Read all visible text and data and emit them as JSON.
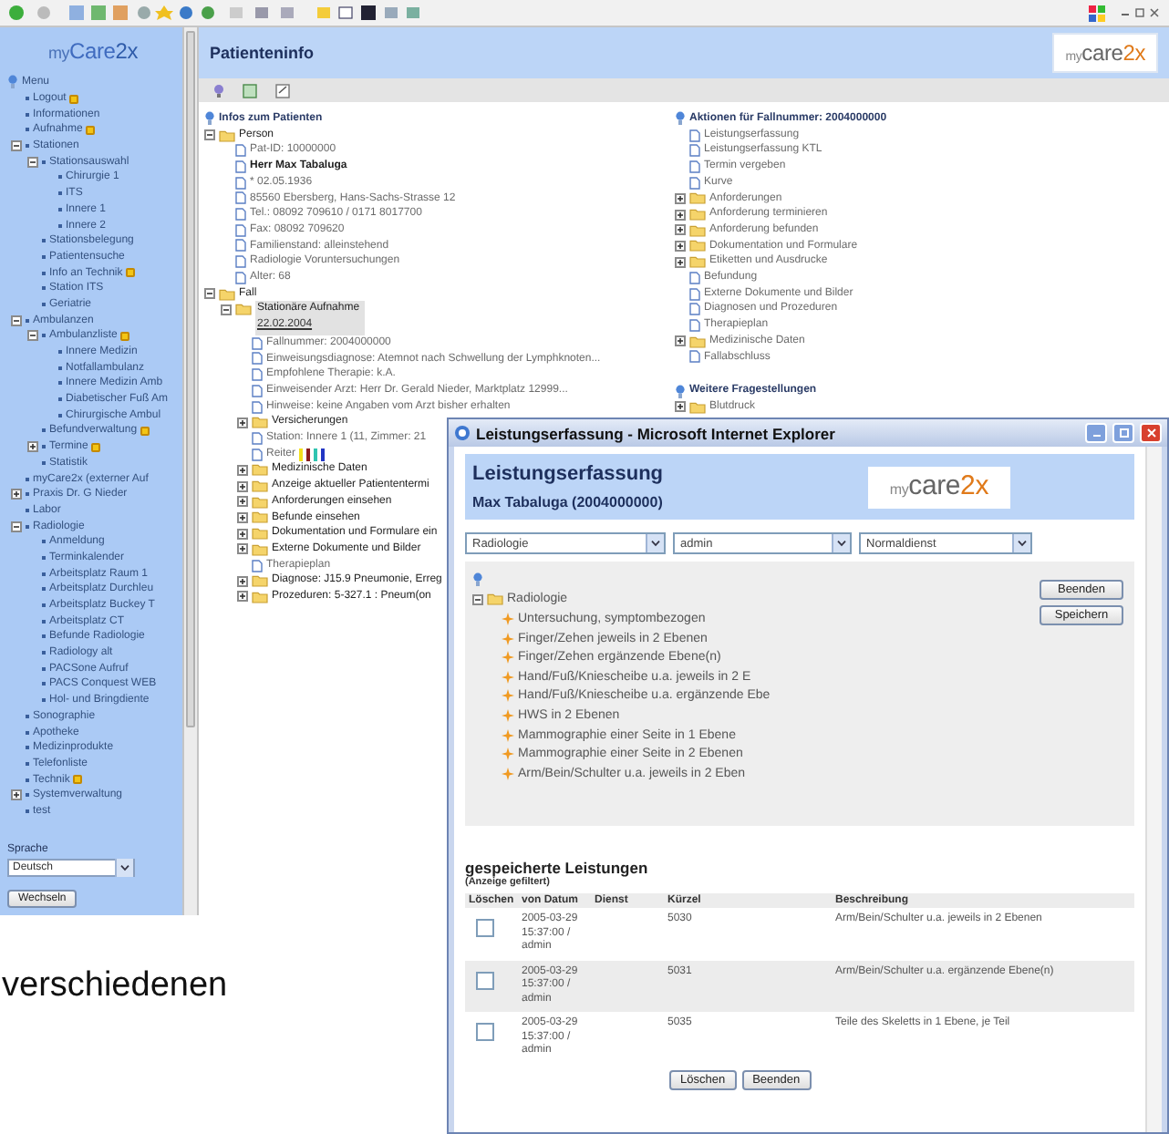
{
  "sidebar": {
    "logo": {
      "prefix": "my",
      "main": "Care",
      "suffix": "2x"
    },
    "menu_label": "Menu",
    "items": [
      {
        "label": "Logout",
        "flagged": true
      },
      {
        "label": "Informationen",
        "flagged": false
      },
      {
        "label": "Aufnahme",
        "flagged": true
      },
      {
        "label": "Stationen",
        "flagged": false,
        "expanded": true,
        "children": [
          {
            "label": "Stationsauswahl",
            "flagged": false,
            "expanded": true,
            "children": [
              {
                "label": "Chirurgie 1",
                "flagged": false
              },
              {
                "label": "ITS",
                "flagged": false
              },
              {
                "label": "Innere 1",
                "flagged": false
              },
              {
                "label": "Innere 2",
                "flagged": false
              }
            ]
          },
          {
            "label": "Stationsbelegung",
            "flagged": false
          },
          {
            "label": "Patientensuche",
            "flagged": false
          },
          {
            "label": "Info an Technik",
            "flagged": true
          },
          {
            "label": "Station ITS",
            "flagged": false
          },
          {
            "label": "Geriatrie",
            "flagged": false
          }
        ]
      },
      {
        "label": "Ambulanzen",
        "flagged": false,
        "expanded": true,
        "children": [
          {
            "label": "Ambulanzliste",
            "flagged": true,
            "expanded": true,
            "children": [
              {
                "label": "Innere Medizin",
                "flagged": false
              },
              {
                "label": "Notfallambulanz",
                "flagged": false
              },
              {
                "label": "Innere Medizin Amb",
                "flagged": false
              },
              {
                "label": "Diabetischer Fuß Am",
                "flagged": false
              },
              {
                "label": "Chirurgische Ambul",
                "flagged": false
              }
            ]
          },
          {
            "label": "Befundverwaltung",
            "flagged": true
          },
          {
            "label": "Termine",
            "flagged": true,
            "expanded": false
          },
          {
            "label": "Statistik",
            "flagged": false
          }
        ]
      },
      {
        "label": "myCare2x (externer Auf",
        "flagged": false
      },
      {
        "label": "Praxis Dr. G Nieder",
        "flagged": false,
        "expanded": false
      },
      {
        "label": "Labor",
        "flagged": false
      },
      {
        "label": "Radiologie",
        "flagged": false,
        "expanded": true,
        "children": [
          {
            "label": "Anmeldung",
            "flagged": false
          },
          {
            "label": "Terminkalender",
            "flagged": false
          },
          {
            "label": "Arbeitsplatz Raum 1",
            "flagged": false
          },
          {
            "label": "Arbeitsplatz Durchleu",
            "flagged": false
          },
          {
            "label": "Arbeitsplatz Buckey T",
            "flagged": false
          },
          {
            "label": "Arbeitsplatz CT",
            "flagged": false
          },
          {
            "label": "Befunde Radiologie",
            "flagged": false
          },
          {
            "label": "Radiology alt",
            "flagged": false
          },
          {
            "label": "PACSone Aufruf",
            "flagged": false
          },
          {
            "label": "PACS Conquest WEB",
            "flagged": false
          },
          {
            "label": "Hol- und Bringdiente",
            "flagged": false
          }
        ]
      },
      {
        "label": "Sonographie",
        "flagged": false
      },
      {
        "label": "Apotheke",
        "flagged": false
      },
      {
        "label": "Medizinprodukte",
        "flagged": false
      },
      {
        "label": "Telefonliste",
        "flagged": false
      },
      {
        "label": "Technik",
        "flagged": true
      },
      {
        "label": "Systemverwaltung",
        "flagged": false,
        "expanded": false
      },
      {
        "label": "test",
        "flagged": false
      }
    ],
    "language_label": "Sprache",
    "language": "Deutsch",
    "switch_button": "Wechseln"
  },
  "page": {
    "title": "Patienteninfo",
    "logo": {
      "prefix": "my",
      "main": "care",
      "suffix": "2x"
    },
    "patient": {
      "header": "Infos zum Patienten",
      "nodes": [
        {
          "label": "Person",
          "expanded": true,
          "selected": false,
          "children": [
            {
              "label": "Pat-ID: 10000000",
              "selected": false
            },
            {
              "label": "Herr Max Tabaluga",
              "bold": true,
              "selected": false
            },
            {
              "label": "* 02.05.1936",
              "selected": false
            },
            {
              "label": "85560 Ebersberg, Hans-Sachs-Strasse 12",
              "selected": false
            },
            {
              "label": "Tel.: 08092 709610 / 0171 8017700",
              "selected": false
            },
            {
              "label": "Fax: 08092 709620",
              "selected": false
            },
            {
              "label": "Familienstand: alleinstehend",
              "selected": false
            },
            {
              "label": "Radiologie Voruntersuchungen",
              "selected": false
            },
            {
              "label": "Alter: 68",
              "selected": false
            }
          ]
        },
        {
          "label": "Fall",
          "expanded": true,
          "selected": false,
          "children": [
            {
              "label": "Stationäre Aufnahme",
              "date": "22.02.2004",
              "expanded": true,
              "selected": true,
              "children": [
                {
                  "label": "Fallnummer: 2004000000",
                  "selected": false
                },
                {
                  "label": "Einweisungsdiagnose: Atemnot nach Schwellung der Lymphknoten...",
                  "selected": false
                },
                {
                  "label": "Empfohlene Therapie: k.A.",
                  "selected": false
                },
                {
                  "label": "Einweisender Arzt: Herr Dr. Gerald Nieder, Marktplatz 12999...",
                  "selected": false
                },
                {
                  "label": "Hinweise: keine Angaben vom Arzt bisher erhalten",
                  "selected": false
                },
                {
                  "label": "Versicherungen",
                  "expanded": false,
                  "selected": false
                },
                {
                  "label": "Station: Innere 1 (11, Zimmer: 21",
                  "selected": false
                },
                {
                  "label": "Reiter",
                  "selected": false,
                  "markers": [
                    {
                      "color": "#f2e01c"
                    },
                    {
                      "color": "#8b1c1c"
                    },
                    {
                      "color": "#2fc4b0"
                    },
                    {
                      "color": "#2236c4"
                    }
                  ]
                },
                {
                  "label": "Medizinische Daten",
                  "expanded": false,
                  "selected": false
                },
                {
                  "label": "Anzeige aktueller Patiententermi",
                  "expanded": false,
                  "selected": false
                },
                {
                  "label": "Anforderungen einsehen",
                  "expanded": false,
                  "selected": false
                },
                {
                  "label": "Befunde einsehen",
                  "expanded": false,
                  "selected": false
                },
                {
                  "label": "Dokumentation und Formulare ein",
                  "expanded": false,
                  "selected": false
                },
                {
                  "label": "Externe Dokumente und Bilder",
                  "expanded": false,
                  "selected": false
                },
                {
                  "label": "Therapieplan",
                  "selected": false
                },
                {
                  "label": "Diagnose: J15.9 Pneumonie, Erreg",
                  "expanded": false,
                  "selected": false
                },
                {
                  "label": "Prozeduren: 5-327.1 : Pneum(on",
                  "expanded": false,
                  "selected": false
                }
              ]
            }
          ]
        }
      ]
    },
    "actions": {
      "header": "Aktionen für Fallnummer: 2004000000",
      "items": [
        {
          "label": "Leistungserfassung"
        },
        {
          "label": "Leistungserfassung KTL"
        },
        {
          "label": "Termin vergeben"
        },
        {
          "label": "Kurve"
        },
        {
          "label": "Anforderungen",
          "expanded": false
        },
        {
          "label": "Anforderung terminieren",
          "expanded": false
        },
        {
          "label": "Anforderung befunden",
          "expanded": false
        },
        {
          "label": "Dokumentation und Formulare",
          "expanded": false
        },
        {
          "label": "Etiketten und Ausdrucke",
          "expanded": false
        },
        {
          "label": "Befundung"
        },
        {
          "label": "Externe Dokumente und Bilder"
        },
        {
          "label": "Diagnosen und Prozeduren"
        },
        {
          "label": "Therapieplan"
        },
        {
          "label": "Medizinische Daten",
          "expanded": false
        },
        {
          "label": "Fallabschluss"
        }
      ]
    },
    "questions": {
      "header": "Weitere Fragestellungen",
      "items": [
        {
          "label": "Blutdruck",
          "expanded": false
        }
      ]
    }
  },
  "dialog": {
    "title": "Leistungserfassung - Microsoft Internet Explorer",
    "heading": "Leistungserfassung",
    "patient": "Max Tabaluga (2004000000)",
    "logo": {
      "prefix": "my",
      "main": "care",
      "suffix": "2x"
    },
    "selects": [
      {
        "value": "Radiologie"
      },
      {
        "value": "admin"
      },
      {
        "value": "Normaldienst"
      }
    ],
    "tree": {
      "label": "Radiologie",
      "expanded": true,
      "items": [
        "Untersuchung, symptombezogen",
        "Finger/Zehen jeweils in 2 Ebenen",
        "Finger/Zehen ergänzende Ebene(n)",
        "Hand/Fuß/Kniescheibe u.a. jeweils in 2 E",
        "Hand/Fuß/Kniescheibe u.a. ergänzende Ebe",
        "HWS in 2 Ebenen",
        "Mammographie einer Seite in 1 Ebene",
        "Mammographie einer Seite in 2 Ebenen",
        "Arm/Bein/Schulter u.a. jeweils in 2 Eben"
      ]
    },
    "buttons": [
      "Beenden",
      "Speichern"
    ],
    "saved": {
      "heading": "gespeicherte Leistungen",
      "note": "(Anzeige gefiltert)",
      "columns": [
        "Löschen",
        "von Datum",
        "Dienst",
        "Kürzel",
        "Beschreibung"
      ],
      "rows": [
        {
          "checked": false,
          "date": "2005-03-29 15:37:00 / admin",
          "code": "5030",
          "description": "Arm/Bein/Schulter u.a. jeweils in 2 Ebenen"
        },
        {
          "checked": false,
          "date": "2005-03-29 15:37:00 / admin",
          "code": "5031",
          "description": "Arm/Bein/Schulter u.a. ergänzende Ebene(n)"
        },
        {
          "checked": false,
          "date": "2005-03-29 15:37:00 / admin",
          "code": "5035",
          "description": "Teile des Skeletts in 1 Ebene, je Teil"
        }
      ]
    },
    "footer_buttons": [
      "Löschen",
      "Beenden"
    ]
  },
  "caption": "verschiedenen"
}
